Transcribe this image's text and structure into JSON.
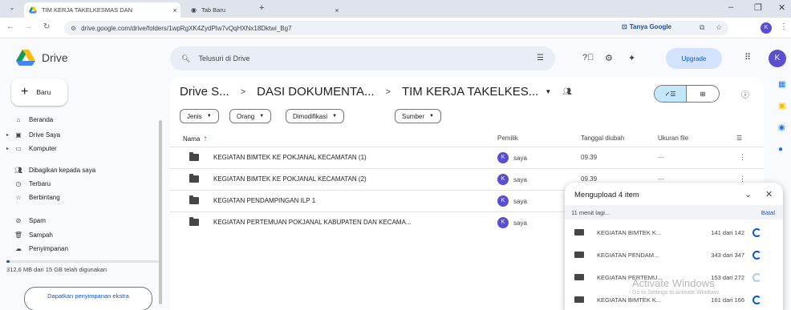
{
  "browser": {
    "tab_menu_icon": "chevron-down-icon",
    "tabs": [
      {
        "title": "TIM KERJA TAKELKESMAS DAN",
        "active": true
      },
      {
        "title": "Tab Baru",
        "active": false
      }
    ],
    "url": "drive.google.com/drive/folders/1wpRgXK4ZydPlw7vQqHXNx18Dktwi_Bg7",
    "tanya_google": "Tanya Google",
    "profile_initial": "K"
  },
  "drive": {
    "logo_text": "Drive",
    "search_placeholder": "Telusuri di Drive",
    "upgrade_label": "Upgrade",
    "avatar_initial": "K",
    "new_button": "Baru",
    "nav": [
      {
        "label": "Beranda",
        "icon": "home-icon"
      },
      {
        "label": "Drive Saya",
        "icon": "drive-icon",
        "expandable": true
      },
      {
        "label": "Komputer",
        "icon": "computer-icon",
        "expandable": true
      },
      {
        "label": "Dibagikan kepada saya",
        "icon": "shared-icon"
      },
      {
        "label": "Terbaru",
        "icon": "clock-icon"
      },
      {
        "label": "Berbintang",
        "icon": "star-icon"
      },
      {
        "label": "Spam",
        "icon": "spam-icon"
      },
      {
        "label": "Sampah",
        "icon": "trash-icon"
      },
      {
        "label": "Penyimpanan",
        "icon": "cloud-icon"
      }
    ],
    "storage_text": "312,6 MB dari 15 GB telah digunakan",
    "storage_fraction": 0.02,
    "get_storage": "Dapatkan penyimpanan ekstra"
  },
  "breadcrumb": {
    "items": [
      "Drive S...",
      "DASI DOKUMENTA...",
      "TIM KERJA TAKELKES..."
    ]
  },
  "filters": [
    "Jenis",
    "Orang",
    "Dimodifikasi",
    "Sumber"
  ],
  "table": {
    "headers": {
      "name": "Nama",
      "owner": "Pemilik",
      "modified": "Tanggal diubah",
      "size": "Ukuran file"
    },
    "rows": [
      {
        "name": "KEGIATAN BIMTEK KE POKJANAL KECAMATAN (1)",
        "owner": "saya",
        "modified": "09.39",
        "size": "—"
      },
      {
        "name": "KEGIATAN BIMTEK KE POKJANAL KECAMATAN (2)",
        "owner": "saya",
        "modified": "09.39",
        "size": "—"
      },
      {
        "name": "KEGIATAN PENDAMPINGAN ILP 1",
        "owner": "saya",
        "modified": "",
        "size": ""
      },
      {
        "name": "KEGIATAN PERTEMUAN POKJANAL KABUPATEN DAN KECAMA...",
        "owner": "saya",
        "modified": "",
        "size": ""
      }
    ]
  },
  "upload": {
    "title": "Mengupload 4 item",
    "time_left": "11 menit lagi...",
    "cancel": "Batal",
    "items": [
      {
        "name": "KEGIATAN BIMTEK K...",
        "count": "141 dari 142"
      },
      {
        "name": "KEGIATAN PENDAM...",
        "count": "343 dari 347"
      },
      {
        "name": "KEGIATAN PERTEMU...",
        "count": "153 dari 272"
      },
      {
        "name": "KEGIATAN BIMTEK K...",
        "count": "161 dari 166"
      }
    ]
  },
  "watermark": {
    "line1": "Activate Windows",
    "line2": "Go to Settings to activate Windows."
  },
  "colors": {
    "accent": "#0b57d0",
    "avatar": "#5a4fcf",
    "selected_view": "#c2e7ff"
  }
}
